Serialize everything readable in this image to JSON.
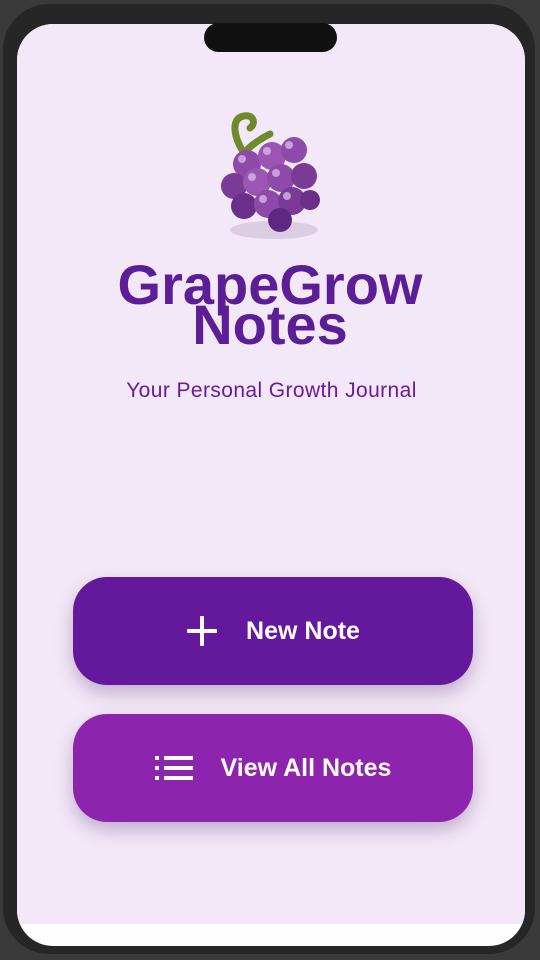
{
  "app": {
    "title_line1": "GrapeGrow",
    "title_line2": "Notes",
    "subtitle": "Your Personal Growth Journal",
    "logo_icon": "grapes-icon"
  },
  "actions": {
    "new_note_label": "New Note",
    "new_note_icon": "plus-icon",
    "view_all_label": "View All Notes",
    "view_all_icon": "list-icon"
  },
  "colors": {
    "background": "#f3e8f7",
    "title": "#5b1e96",
    "primary_button": "#64199d",
    "secondary_button": "#8d24ad"
  }
}
